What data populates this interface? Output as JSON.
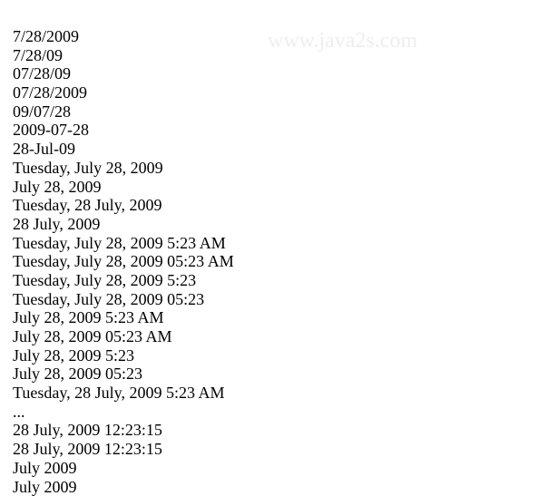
{
  "watermark": "www.java2s.com",
  "lines": [
    "7/28/2009",
    "7/28/09",
    "07/28/09",
    "07/28/2009",
    "09/07/28",
    "2009-07-28",
    "28-Jul-09",
    "Tuesday, July 28, 2009",
    "July 28, 2009",
    "Tuesday, 28 July, 2009",
    "28 July, 2009",
    "Tuesday, July 28, 2009 5:23 AM",
    "Tuesday, July 28, 2009 05:23 AM",
    "Tuesday, July 28, 2009 5:23",
    "Tuesday, July 28, 2009 05:23",
    "July 28, 2009 5:23 AM",
    "July 28, 2009 05:23 AM",
    "July 28, 2009 5:23",
    "July 28, 2009 05:23",
    "Tuesday, 28 July, 2009 5:23 AM",
    "...",
    "28 July, 2009 12:23:15",
    "28 July, 2009 12:23:15",
    "July 2009",
    "July 2009"
  ]
}
